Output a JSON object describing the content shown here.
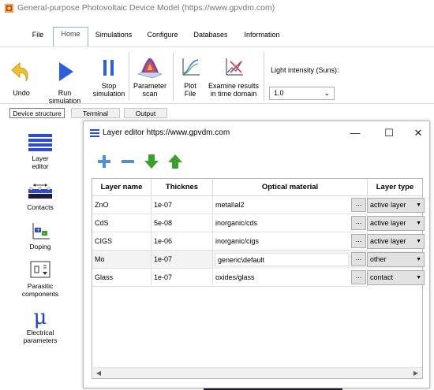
{
  "window": {
    "title": "General-purpose Photovoltaic Device Model (https://www.gpvdm.com)"
  },
  "ribbon_tabs": [
    "File",
    "Home",
    "Simulations",
    "Configure",
    "Databases",
    "Information"
  ],
  "ribbon_buttons": {
    "undo": "Undo",
    "run": "Run simulation",
    "stop_l1": "Stop",
    "stop_l2": "simulation",
    "param_l1": "Parameter",
    "param_l2": "scan",
    "plot_l1": "Plot",
    "plot_l2": "File",
    "examine_l1": "Examine results",
    "examine_l2": "in time domain"
  },
  "light_intensity": {
    "label": "Light intensity (Suns):",
    "value": "1.0"
  },
  "left_tabs": [
    "Device structure",
    "Terminal",
    "Output"
  ],
  "left_panel": {
    "layer_editor_l1": "Layer",
    "layer_editor_l2": "editor",
    "contacts": "Contacts",
    "doping": "Doping",
    "parasitic_l1": "Parasitic",
    "parasitic_l2": "components",
    "electrical_symbol": "μ",
    "electrical_l1": "Electrical",
    "electrical_l2": "parameters"
  },
  "dialog": {
    "title": "Layer editor https://www.gpvdm.com",
    "headers": [
      "Layer name",
      "Thicknes",
      "Optical material",
      "Layer type"
    ],
    "rows": [
      {
        "name": "ZnO",
        "thickness": "1e-07",
        "material": "metal\\al2",
        "type": "active layer"
      },
      {
        "name": "CdS",
        "thickness": "5e-08",
        "material": "inorganic/cds",
        "type": "active layer"
      },
      {
        "name": "CIGS",
        "thickness": "1e-06",
        "material": "inorganic/cigs",
        "type": "active layer"
      },
      {
        "name": "Mo",
        "thickness": "1e-07",
        "material": "generic\\default",
        "type": "other"
      },
      {
        "name": "Glass",
        "thickness": "1e-07",
        "material": "oxides/glass",
        "type": "contact"
      }
    ],
    "dots_label": "..."
  },
  "colors": {
    "accent": "#1e64c8",
    "tab_border": "#88b6e6",
    "green": "#3aa02a",
    "blue_button": "#2b5fe0"
  }
}
